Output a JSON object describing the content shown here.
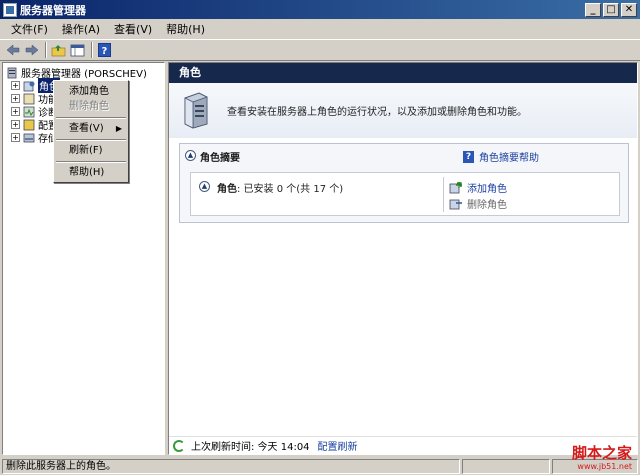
{
  "window": {
    "title": "服务器管理器"
  },
  "window_buttons": [
    "_",
    "□",
    "✕"
  ],
  "menu": [
    "文件(F)",
    "操作(A)",
    "查看(V)",
    "帮助(H)"
  ],
  "toolbar": {
    "back_icon": "back-arrow-icon",
    "forward_icon": "forward-arrow-icon",
    "up_icon": "up-folder-icon",
    "show_hide_icon": "console-tree-icon",
    "help_icon": "help-icon",
    "help_glyph": "?"
  },
  "tree": {
    "root": "服务器管理器 (PORSCHEV)",
    "items": [
      "角色",
      "功能",
      "诊断",
      "配置",
      "存储"
    ]
  },
  "context_menu": {
    "items": [
      {
        "label": "添加角色",
        "enabled": true
      },
      {
        "label": "删除角色",
        "enabled": false
      },
      {
        "label": "查看(V)",
        "enabled": true,
        "submenu": true
      },
      {
        "label": "刷新(F)",
        "enabled": true
      },
      {
        "label": "帮助(H)",
        "enabled": true
      }
    ]
  },
  "main": {
    "header": "角色",
    "intro": "查看安装在服务器上角色的运行状况，以及添加或删除角色和功能。",
    "summary": {
      "title": "角色摘要",
      "help_link": "角色摘要帮助",
      "roles_label": "角色",
      "roles_status": ": 已安装 0 个(共 17 个)",
      "add_role": "添加角色",
      "remove_role": "删除角色"
    },
    "refresh": {
      "label": "上次刷新时间: 今天 14:04",
      "link": "配置刷新"
    }
  },
  "status": {
    "text": "删除此服务器上的角色。"
  },
  "watermark": {
    "main": "脚本之家",
    "sub": "www.jb51.net"
  }
}
